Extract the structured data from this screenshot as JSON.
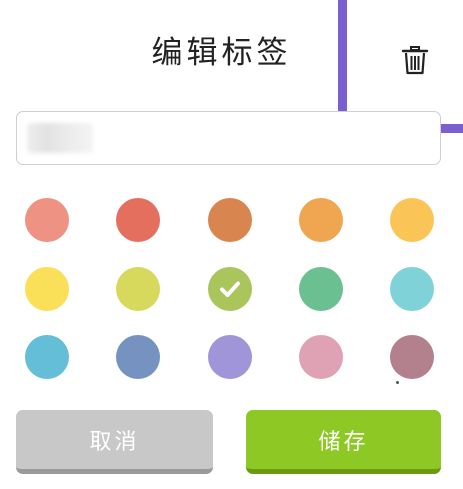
{
  "header": {
    "title": "编辑标签",
    "delete_icon": "trash-icon"
  },
  "name_field": {
    "value": "",
    "placeholder": ""
  },
  "palette": {
    "selected_index": 7,
    "colors": [
      "#ee9383",
      "#e46f5f",
      "#d9854f",
      "#f0a551",
      "#fbc457",
      "#fadf59",
      "#d6d95b",
      "#a9c55c",
      "#6bc091",
      "#7fd2d8",
      "#64bed7",
      "#7592c0",
      "#a095d9",
      "#dfa1b4",
      "#b3818d"
    ]
  },
  "actions": {
    "cancel_label": "取消",
    "save_label": "储存"
  },
  "colors": {
    "annotation": "#7a5fd0",
    "cancel_bg": "#c8c8c8",
    "save_bg": "#8dc824"
  }
}
